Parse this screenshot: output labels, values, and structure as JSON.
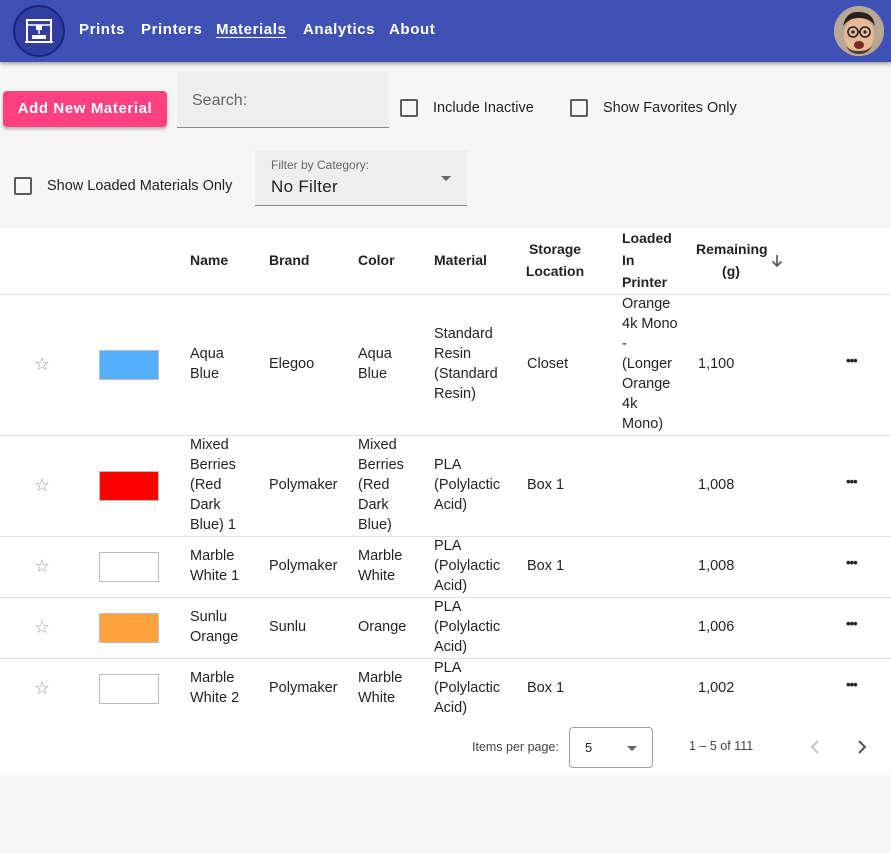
{
  "nav": {
    "links": [
      "Prints",
      "Printers",
      "Materials",
      "Analytics",
      "About"
    ],
    "active": "Materials"
  },
  "toolbar": {
    "add_button": "Add New Material",
    "search_placeholder": "Search:",
    "include_inactive": "Include Inactive",
    "show_favorites": "Show Favorites Only",
    "show_loaded": "Show Loaded Materials Only",
    "category_filter": {
      "label": "Filter by Category:",
      "value": "No Filter"
    }
  },
  "table": {
    "headers": {
      "name": "Name",
      "brand": "Brand",
      "color": "Color",
      "material": "Material",
      "storage": "Storage Location",
      "loaded": "Loaded In Printer",
      "remaining": "Remaining (g)"
    },
    "sort_column": "Remaining (g)",
    "sort_direction": "descending",
    "rows": [
      {
        "favorite": false,
        "swatch": "#54b0fd",
        "name": "Aqua Blue",
        "brand": "Elegoo",
        "color": "Aqua Blue",
        "material": "Standard Resin (Standard Resin)",
        "storage": "Closet",
        "loaded": "Orange 4k Mono - (Longer Orange 4k Mono)",
        "remaining": "1,100"
      },
      {
        "favorite": false,
        "swatch": "#ff0000",
        "name": "Mixed Berries (Red Dark Blue) 1",
        "brand": "Polymaker",
        "color": "Mixed Berries (Red Dark Blue)",
        "material": "PLA (Polylactic Acid)",
        "storage": "Box 1",
        "loaded": "",
        "remaining": "1,008"
      },
      {
        "favorite": false,
        "swatch": "#ffffff",
        "name": "Marble White 1",
        "brand": "Polymaker",
        "color": "Marble White",
        "material": "PLA (Polylactic Acid)",
        "storage": "Box 1",
        "loaded": "",
        "remaining": "1,008"
      },
      {
        "favorite": false,
        "swatch": "#ffa33f",
        "name": "Sunlu Orange",
        "brand": "Sunlu",
        "color": "Orange",
        "material": "PLA (Polylactic Acid)",
        "storage": "",
        "loaded": "",
        "remaining": "1,006"
      },
      {
        "favorite": false,
        "swatch": "#ffffff",
        "name": "Marble White 2",
        "brand": "Polymaker",
        "color": "Marble White",
        "material": "PLA (Polylactic Acid)",
        "storage": "Box 1",
        "loaded": "",
        "remaining": "1,002"
      }
    ]
  },
  "paginator": {
    "items_per_page_label": "Items per page:",
    "items_per_page": "5",
    "range": "1 – 5 of 111"
  },
  "icons": {
    "favorite": "star-outline-icon",
    "more": "more-horiz-icon",
    "sort": "arrow-downward-icon",
    "prev": "chevron-left-icon",
    "next": "chevron-right-icon",
    "dropdown": "caret-down-icon"
  },
  "colors": {
    "primary": "#3f51b5",
    "accent": "#ff4081"
  }
}
